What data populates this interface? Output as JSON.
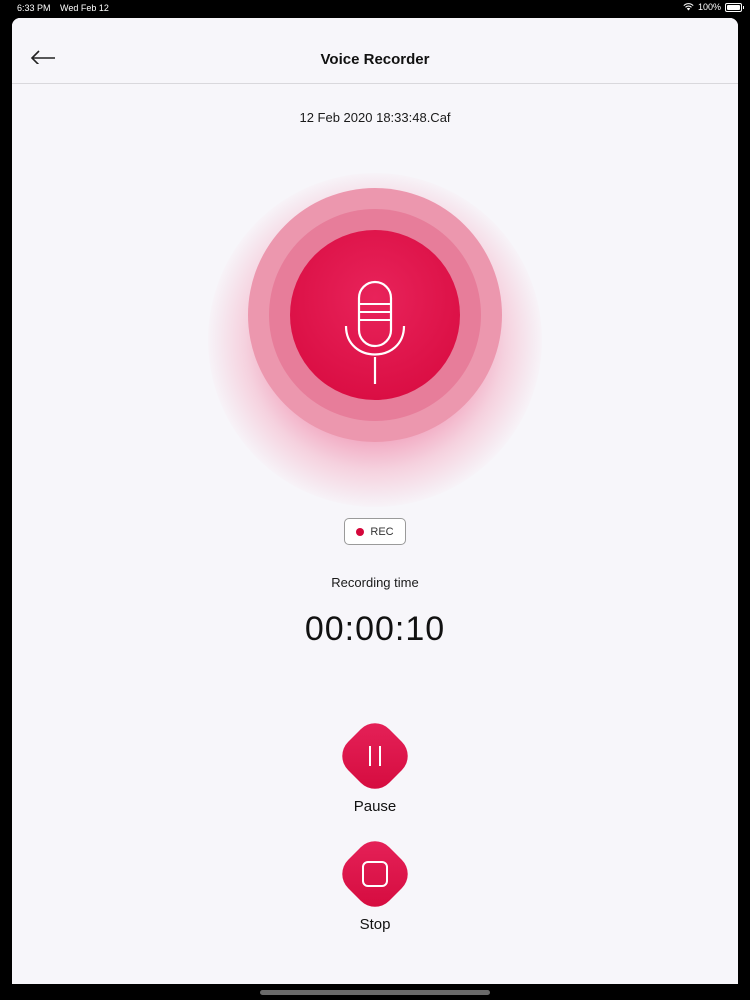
{
  "status_bar": {
    "time": "6:33 PM",
    "date": "Wed Feb 12",
    "battery": "100%"
  },
  "nav": {
    "title": "Voice Recorder",
    "back_icon": "arrow-left-icon"
  },
  "recording": {
    "file_name": "12 Feb 2020 18:33:48.Caf",
    "badge": "REC",
    "time_label": "Recording time",
    "elapsed": "00:00:10"
  },
  "controls": {
    "pause_label": "Pause",
    "stop_label": "Stop"
  },
  "colors": {
    "accent": "#d6083d",
    "background": "#f7f6fa"
  }
}
